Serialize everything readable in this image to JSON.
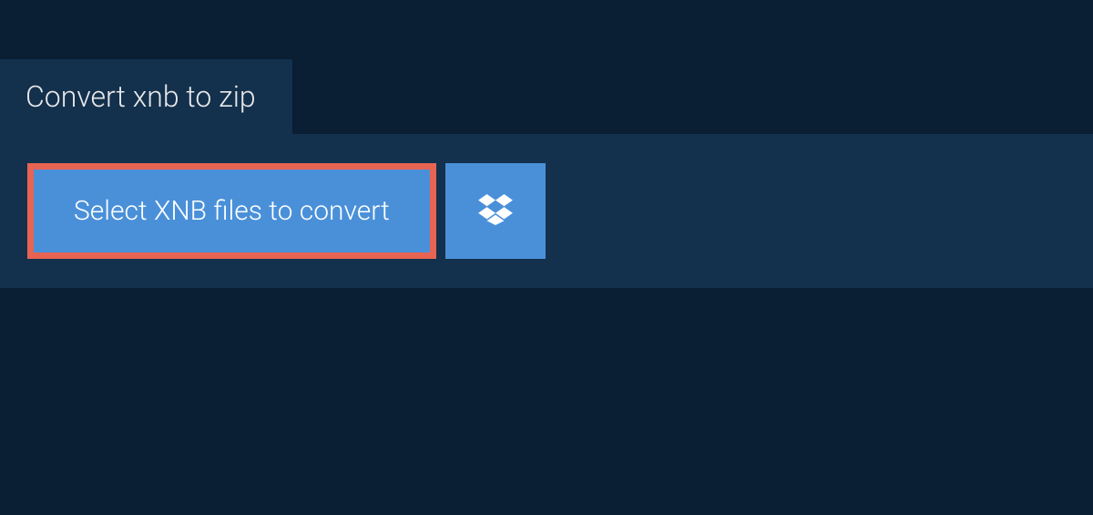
{
  "tab": {
    "label": "Convert xnb to zip"
  },
  "buttons": {
    "select_label": "Select XNB files to convert"
  },
  "colors": {
    "page_bg": "#0a1f33",
    "panel_bg": "#13304d",
    "button_bg": "#4a90d9",
    "highlight_border": "#e86452",
    "text_light": "#ffffff"
  }
}
